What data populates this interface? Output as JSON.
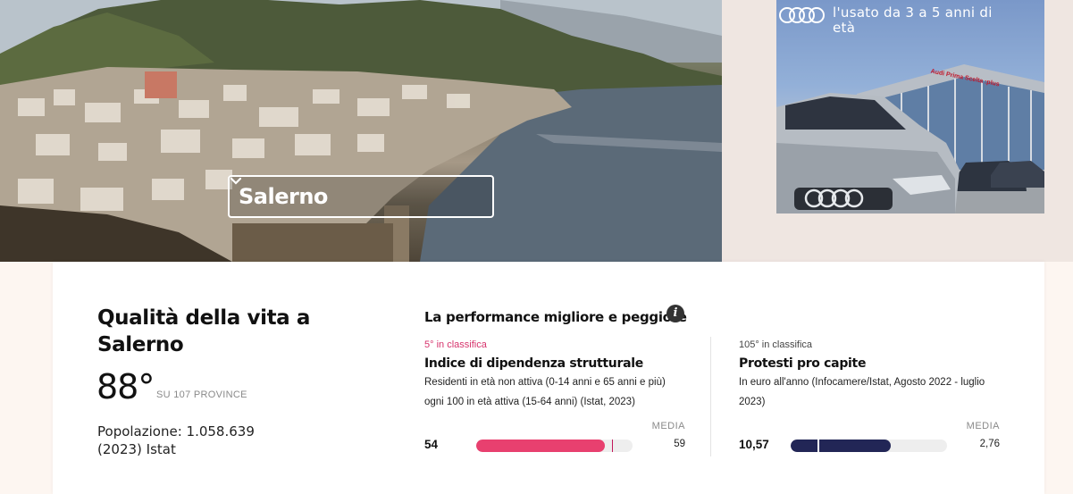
{
  "hero": {
    "city_select": {
      "value": "Salerno"
    }
  },
  "ad": {
    "text": "l'usato da 3 a 5 anni di età",
    "showroom_sign": "Audi Prima Scelta :plus"
  },
  "card": {
    "title": "Qualità della vita a Salerno",
    "score": "88°",
    "score_sub": "SU 107 PROVINCE",
    "population": "Popolazione: 1.058.639 (2023) Istat",
    "performance_title": "La performance migliore e peggiore",
    "best": {
      "rank": "5° in classifica",
      "name": "Indice di dipendenza strutturale",
      "desc": "Residenti in età non attiva (0-14 anni e 65 anni e più) ogni 100 in età attiva (15-64 anni) (Istat, 2023)",
      "media_label": "MEDIA",
      "value": "54",
      "avg": "59",
      "fill_fraction": 0.82,
      "marker_fraction": 0.87,
      "color": "#e8406f"
    },
    "worst": {
      "rank": "105° in classifica",
      "name": "Protesti pro capite",
      "desc": "In euro all'anno (Infocamere/Istat, Agosto 2022 - luglio 2023)",
      "media_label": "MEDIA",
      "value": "10,57",
      "avg": "2,76",
      "fill_fraction": 0.64,
      "marker_fraction": 0.17,
      "color": "#222656"
    }
  }
}
